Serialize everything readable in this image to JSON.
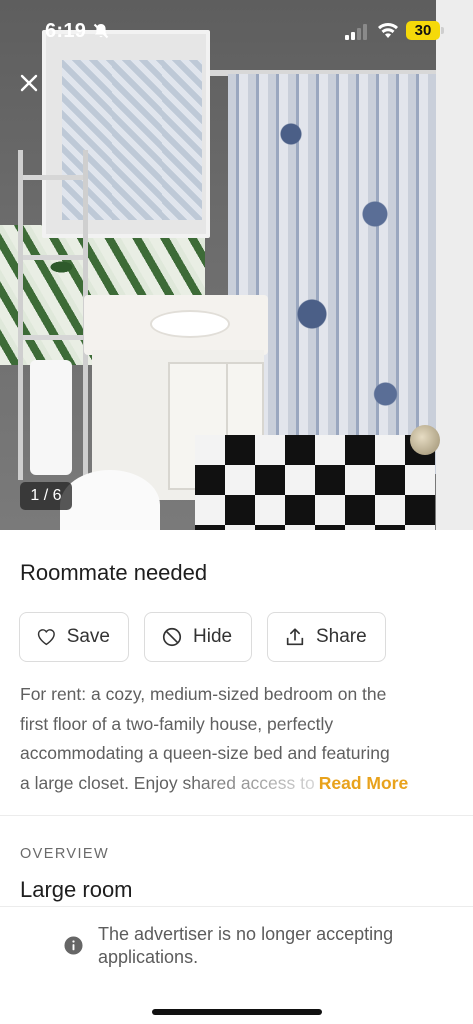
{
  "status_bar": {
    "time": "6:19",
    "battery": "30",
    "icons": [
      "bell-off-icon",
      "signal-icon",
      "wifi-icon",
      "battery-icon"
    ]
  },
  "gallery": {
    "counter": "1 / 6",
    "close_icon": "close-icon"
  },
  "listing": {
    "title": "Roommate needed",
    "actions": {
      "save_label": "Save",
      "hide_label": "Hide",
      "share_label": "Share"
    },
    "description_lines": [
      "For rent: a cozy, medium-sized bedroom on the",
      "first floor of a two-family house, perfectly",
      "accommodating a queen-size bed and featuring"
    ],
    "description_last_line": "a large closet. Enjoy shared access to",
    "read_more_label": "Read More"
  },
  "overview": {
    "heading": "OVERVIEW",
    "value": "Large room"
  },
  "notice": {
    "text": "The advertiser is no longer accepting applications."
  },
  "colors": {
    "accent": "#e8a21c",
    "battery": "#f5d90a",
    "text_primary": "#1e1e1e",
    "text_secondary": "#5f5f5f"
  }
}
